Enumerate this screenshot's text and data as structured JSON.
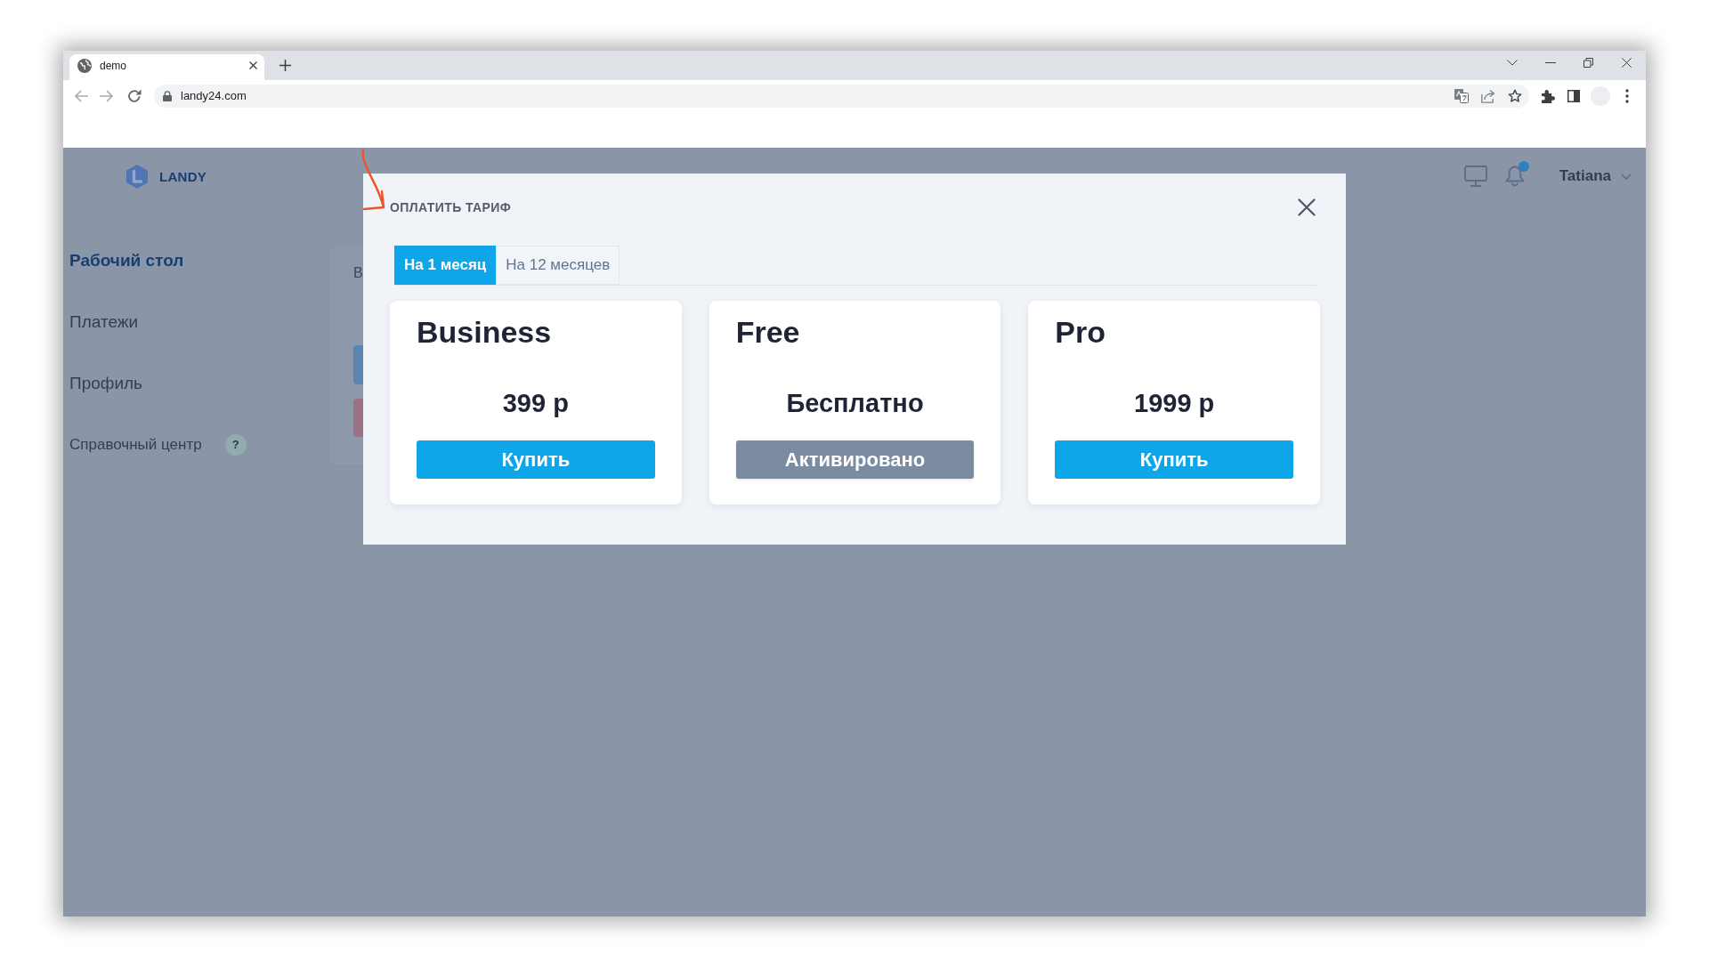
{
  "browser": {
    "tab": {
      "title": "demo"
    },
    "address_bar": {
      "url": "landy24.com"
    }
  },
  "header": {
    "logo": "LANDY",
    "notifications": {
      "unread": true
    },
    "user": {
      "name": "Tatiana"
    }
  },
  "sidebar": {
    "items": [
      {
        "label": "Рабочий стол",
        "kind": "main",
        "selected": true
      },
      {
        "label": "Платежи",
        "kind": "main",
        "selected": false
      },
      {
        "label": "Профиль",
        "kind": "main",
        "selected": false
      },
      {
        "label": "Справочный центр",
        "kind": "help",
        "selected": false,
        "badge": "?"
      }
    ]
  },
  "content_card": {
    "title": "В"
  },
  "modal": {
    "title": "ОПЛАТИТЬ ТАРИФ",
    "tabs": [
      {
        "label": "На 1 месяц",
        "selected": true
      },
      {
        "label": "На 12 месяцев",
        "selected": false
      }
    ],
    "plans": [
      {
        "name": "Business",
        "price": "399 р",
        "button": "Купить",
        "disabled": false
      },
      {
        "name": "Free",
        "price": "Бесплатно",
        "button": "Активировано",
        "disabled": true
      },
      {
        "name": "Pro",
        "price": "1999 р",
        "button": "Купить",
        "disabled": false
      }
    ]
  }
}
